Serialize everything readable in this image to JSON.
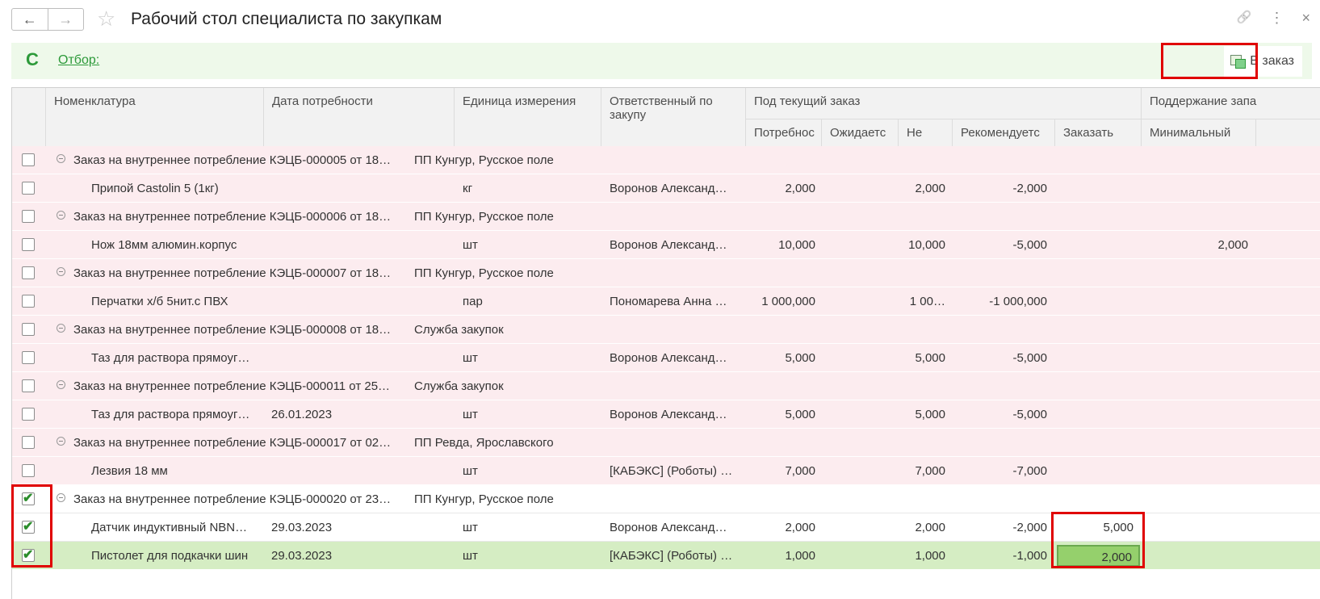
{
  "window": {
    "title": "Рабочий стол специалиста по закупкам",
    "back_arrow": "←",
    "forward_arrow": "→",
    "star_glyph": "☆",
    "link_glyph": "🔗",
    "more_glyph": "⋮",
    "close_glyph": "×"
  },
  "toolbar": {
    "refresh_glyph": "C",
    "filter_label": "Отбор:",
    "in_order_label": "В заказ"
  },
  "grid": {
    "headers": {
      "nomenclature": "Номенклатура",
      "need_date": "Дата потребности",
      "unit": "Единица измерения",
      "responsible": "Ответственный по закупу",
      "current_order": "Под текущий заказ",
      "need": "Потребнос",
      "expected": "Ожидаетс",
      "not": "Не",
      "recommended": "Рекомендуетс",
      "to_order": "Заказать",
      "stock_support": "Поддержание запа",
      "minimal": "Минимальный"
    },
    "rows": [
      {
        "kind": "group",
        "checked": false,
        "text": "Заказ на внутреннее потребление КЭЦБ-000005 от 18…",
        "division": "ПП Кунгур, Русское поле"
      },
      {
        "kind": "item",
        "checked": false,
        "name": "Припой Castolin 5 (1кг)",
        "date": "",
        "unit": "кг",
        "responsible": "Воронов Александ…",
        "need": "2,000",
        "expected": "",
        "not": "2,000",
        "recommended": "-2,000",
        "order": "",
        "minimal": ""
      },
      {
        "kind": "group",
        "checked": false,
        "text": "Заказ на внутреннее потребление КЭЦБ-000006 от 18…",
        "division": "ПП Кунгур, Русское поле"
      },
      {
        "kind": "item",
        "checked": false,
        "name": "Нож 18мм алюмин.корпус",
        "date": "",
        "unit": "шт",
        "responsible": "Воронов Александ…",
        "need": "10,000",
        "expected": "",
        "not": "10,000",
        "recommended": "-5,000",
        "order": "",
        "minimal": "2,000"
      },
      {
        "kind": "group",
        "checked": false,
        "text": "Заказ на внутреннее потребление КЭЦБ-000007 от 18…",
        "division": "ПП Кунгур, Русское поле"
      },
      {
        "kind": "item",
        "checked": false,
        "name": "Перчатки х/б 5нит.с ПВХ",
        "date": "",
        "unit": "пар",
        "responsible": "Пономарева Анна …",
        "need": "1 000,000",
        "expected": "",
        "not": "1 00…",
        "recommended": "-1 000,000",
        "order": "",
        "minimal": ""
      },
      {
        "kind": "group",
        "checked": false,
        "text": "Заказ на внутреннее потребление КЭЦБ-000008 от 18…",
        "division": "Служба закупок"
      },
      {
        "kind": "item",
        "checked": false,
        "name": "Таз для раствора прямоуг…",
        "date": "",
        "unit": "шт",
        "responsible": "Воронов Александ…",
        "need": "5,000",
        "expected": "",
        "not": "5,000",
        "recommended": "-5,000",
        "order": "",
        "minimal": ""
      },
      {
        "kind": "group",
        "checked": false,
        "text": "Заказ на внутреннее потребление КЭЦБ-000011 от 25…",
        "division": "Служба закупок"
      },
      {
        "kind": "item",
        "checked": false,
        "name": "Таз для раствора прямоуг…",
        "date": "26.01.2023",
        "unit": "шт",
        "responsible": "Воронов Александ…",
        "need": "5,000",
        "expected": "",
        "not": "5,000",
        "recommended": "-5,000",
        "order": "",
        "minimal": ""
      },
      {
        "kind": "group",
        "checked": false,
        "text": "Заказ на внутреннее потребление КЭЦБ-000017 от 02…",
        "division": "ПП Ревда, Ярославского"
      },
      {
        "kind": "item",
        "checked": false,
        "name": "Лезвия 18 мм",
        "date": "",
        "unit": "шт",
        "responsible": "[КАБЭКС] (Роботы) …",
        "need": "7,000",
        "expected": "",
        "not": "7,000",
        "recommended": "-7,000",
        "order": "",
        "minimal": ""
      },
      {
        "kind": "group",
        "checked": true,
        "text": "Заказ на внутреннее потребление КЭЦБ-000020 от 23…",
        "division": "ПП Кунгур, Русское поле"
      },
      {
        "kind": "item",
        "checked": true,
        "name": "Датчик индуктивный NBN…",
        "date": "29.03.2023",
        "unit": "шт",
        "responsible": "Воронов Александ…",
        "need": "2,000",
        "expected": "",
        "not": "2,000",
        "recommended": "-2,000",
        "order": "5,000",
        "minimal": ""
      },
      {
        "kind": "item",
        "checked": true,
        "name": "Пистолет для подкачки шин",
        "date": "29.03.2023",
        "unit": "шт",
        "responsible": "[КАБЭКС] (Роботы) …",
        "need": "1,000",
        "expected": "",
        "not": "1,000",
        "recommended": "-1,000",
        "order": "2,000",
        "minimal": ""
      }
    ]
  }
}
